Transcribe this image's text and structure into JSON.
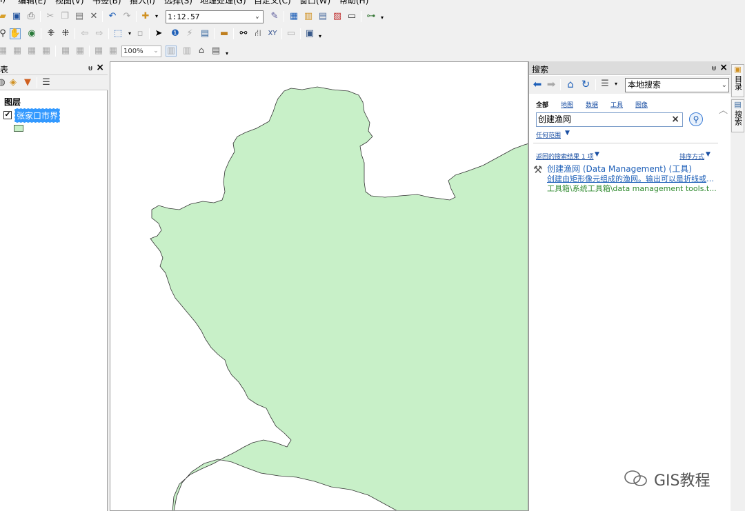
{
  "menu": {
    "items": [
      "I)",
      "编辑(E)",
      "视图(V)",
      "书签(B)",
      "插入(I)",
      "选择(S)",
      "地理处理(G)",
      "自定义(C)",
      "窗口(W)",
      "帮助(H)"
    ]
  },
  "toolbar": {
    "scale_value": "1:12.57",
    "zoom_value": "100%"
  },
  "toc": {
    "title": "表",
    "pin": "ᵾ",
    "layers_label": "图层",
    "layer_name": "张家口市界",
    "layer_checked": true,
    "fill_color": "#c8f0c8"
  },
  "map": {
    "fill_color": "#c8f0c8",
    "outline_color": "#333333"
  },
  "search": {
    "title": "搜索",
    "scope": "本地搜索",
    "tabs": [
      "全部",
      "地图",
      "数据",
      "工具",
      "图像"
    ],
    "query": "创建渔网",
    "extent": "任何范围",
    "result_count": "返回的搜索结果 1 项",
    "sort": "排序方式",
    "result": {
      "title": "创建渔网 (Data Management) (工具)",
      "description": "创建由矩形像元组成的渔网。输出可以是折线或面...",
      "path": "工具箱\\系统工具箱\\data management tools.t..."
    }
  },
  "side_tabs": [
    "目录",
    "搜索"
  ],
  "watermark": "GIS教程"
}
